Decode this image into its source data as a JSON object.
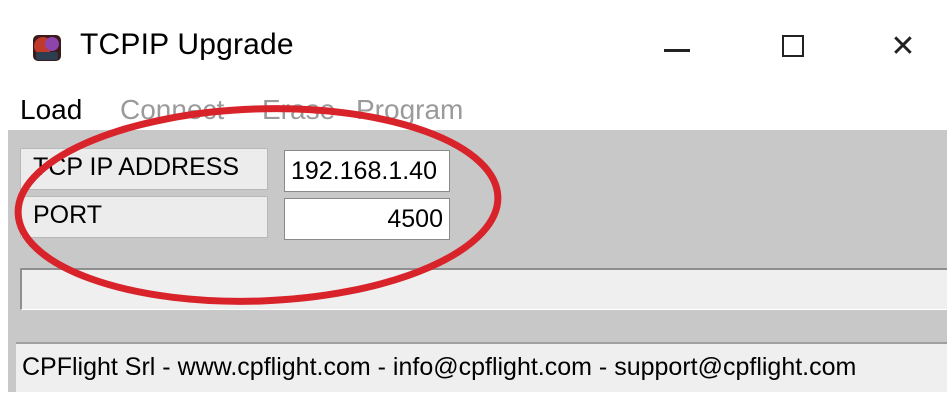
{
  "window": {
    "title": "TCPIP Upgrade",
    "icon": "app-icon",
    "controls": {
      "minimize": "minimize-icon",
      "maximize": "maximize-icon",
      "close": "close-icon"
    },
    "close_glyph": "✕"
  },
  "menu": {
    "items": [
      {
        "label": "Load",
        "enabled": true
      },
      {
        "label": "Connect",
        "enabled": false
      },
      {
        "label": "Erase",
        "enabled": false
      },
      {
        "label": "Program",
        "enabled": false
      }
    ]
  },
  "form": {
    "ip_label": "TCP IP ADDRESS",
    "ip_value": "192.168.1.40",
    "port_label": "PORT",
    "port_value": "4500"
  },
  "progress": {
    "value": 0
  },
  "status": {
    "text": "CPFlight Srl -  www.cpflight.com - info@cpflight.com - support@cpflight.com"
  },
  "colors": {
    "client_background": "#c8c8c8",
    "annotation_ellipse": "#d8232a"
  }
}
